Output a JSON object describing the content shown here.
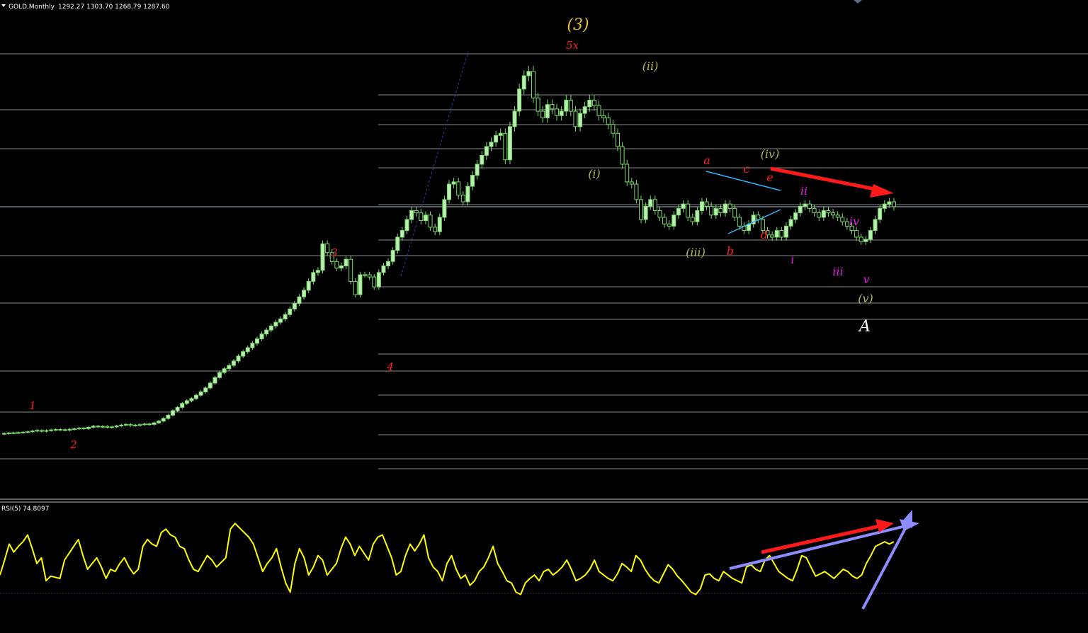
{
  "header": {
    "symbol": "GOLD,Monthly",
    "ohlc": "1292.27 1303.70 1268.79 1287.60",
    "rsi_label": "RSI(5) 74.8097"
  },
  "colors": {
    "background": "#000000",
    "bull_candle": "#b8f0b0",
    "wick": "#7ddc6e",
    "grid": "#8a8a8a",
    "rsi_line": "#ffff00",
    "red_arrow": "#ff1a1a",
    "blue_arrow": "#8c8cff",
    "triangle": "#33b5ff",
    "wave_red": "#ff2020",
    "wave_olive": "#b5b560",
    "wave_magenta": "#e020e0",
    "wave_gold": "#e8c030",
    "wave_white": "#ffffff"
  },
  "chart_data": [
    {
      "type": "candlestick",
      "symbol": "GOLD",
      "timeframe": "Monthly",
      "last_bar": {
        "open": 1292.27,
        "high": 1303.7,
        "low": 1268.79,
        "close": 1287.6
      },
      "closes": [
        262,
        264,
        265,
        266,
        268,
        270,
        273,
        276,
        272,
        275,
        278,
        280,
        279,
        277,
        281,
        283,
        286,
        284,
        290,
        295,
        292,
        294,
        290,
        292,
        296,
        300,
        303,
        298,
        300,
        302,
        305,
        303,
        310,
        318,
        330,
        345,
        365,
        380,
        398,
        410,
        420,
        435,
        450,
        468,
        490,
        515,
        538,
        555,
        570,
        590,
        612,
        632,
        650,
        670,
        690,
        712,
        730,
        748,
        765,
        780,
        800,
        825,
        850,
        880,
        910,
        950,
        990,
        1000,
        1120,
        1080,
        1040,
        1010,
        1020,
        1050,
        950,
        890,
        980,
        980,
        970,
        925,
        990,
        1020,
        1040,
        1090,
        1150,
        1180,
        1230,
        1270,
        1260,
        1225,
        1250,
        1195,
        1175,
        1240,
        1320,
        1390,
        1400,
        1340,
        1310,
        1380,
        1430,
        1480,
        1520,
        1560,
        1580,
        1610,
        1620,
        1500,
        1650,
        1720,
        1820,
        1880,
        1900,
        1780,
        1720,
        1690,
        1750,
        1730,
        1700,
        1720,
        1770,
        1720,
        1650,
        1710,
        1740,
        1770,
        1745,
        1700,
        1690,
        1660,
        1620,
        1560,
        1480,
        1400,
        1390,
        1320,
        1230,
        1290,
        1320,
        1270,
        1240,
        1210,
        1200,
        1250,
        1280,
        1300,
        1240,
        1220,
        1270,
        1310,
        1290,
        1250,
        1280,
        1260,
        1300,
        1280,
        1240,
        1200,
        1180,
        1210,
        1250,
        1230,
        1180,
        1160,
        1150,
        1180,
        1150,
        1200,
        1230,
        1260,
        1290,
        1300,
        1280,
        1260,
        1240,
        1270,
        1260,
        1250,
        1240,
        1220,
        1200,
        1180,
        1150,
        1130,
        1140,
        1180,
        1230,
        1280,
        1300,
        1310,
        1288
      ]
    },
    {
      "type": "line",
      "name": "RSI(5)",
      "current": 74.8097,
      "values": [
        45,
        58,
        72,
        65,
        70,
        74,
        80,
        68,
        55,
        60,
        40,
        44,
        43,
        42,
        58,
        64,
        70,
        76,
        62,
        50,
        55,
        60,
        52,
        42,
        50,
        48,
        55,
        60,
        52,
        46,
        50,
        70,
        76,
        72,
        70,
        82,
        85,
        80,
        78,
        70,
        68,
        58,
        50,
        48,
        55,
        62,
        58,
        52,
        56,
        60,
        85,
        90,
        86,
        82,
        78,
        72,
        60,
        48,
        55,
        60,
        68,
        52,
        38,
        30,
        55,
        68,
        60,
        45,
        52,
        62,
        58,
        45,
        50,
        55,
        68,
        78,
        72,
        62,
        70,
        64,
        58,
        72,
        78,
        80,
        70,
        60,
        45,
        48,
        62,
        72,
        66,
        72,
        80,
        60,
        52,
        48,
        40,
        55,
        62,
        50,
        42,
        45,
        36,
        40,
        48,
        52,
        60,
        70,
        55,
        48,
        40,
        38,
        30,
        28,
        38,
        42,
        45,
        40,
        48,
        50,
        45,
        48,
        52,
        58,
        50,
        40,
        42,
        45,
        50,
        58,
        48,
        45,
        42,
        40,
        46,
        55,
        52,
        48,
        62,
        58,
        50,
        44,
        40,
        38,
        46,
        54,
        50,
        44,
        40,
        35,
        30,
        28,
        33,
        45,
        46,
        42,
        40,
        48,
        45,
        42,
        40,
        38,
        52,
        54,
        50,
        48,
        58,
        62,
        55,
        48,
        45,
        42,
        40,
        50,
        62,
        60,
        52,
        44,
        46,
        48,
        45,
        42,
        46,
        50,
        48,
        44,
        42,
        45,
        55,
        62,
        70,
        72,
        74,
        72,
        74
      ]
    }
  ],
  "wave_labels": {
    "red_1": "1",
    "red_2": "2",
    "red_3": "3",
    "red_4": "4",
    "red_5x": "5x",
    "gold_3": "(3)",
    "olive_i": "(i)",
    "olive_ii": "(ii)",
    "olive_iii": "(iii)",
    "olive_iv": "(iv)",
    "olive_v": "(v)",
    "red_a": "a",
    "red_b": "b",
    "red_c": "c",
    "red_d": "d",
    "red_e": "e",
    "mag_i": "i",
    "mag_ii": "ii",
    "mag_iii": "iii",
    "mag_iv": "iv",
    "mag_v": "v",
    "white_A": "A"
  }
}
